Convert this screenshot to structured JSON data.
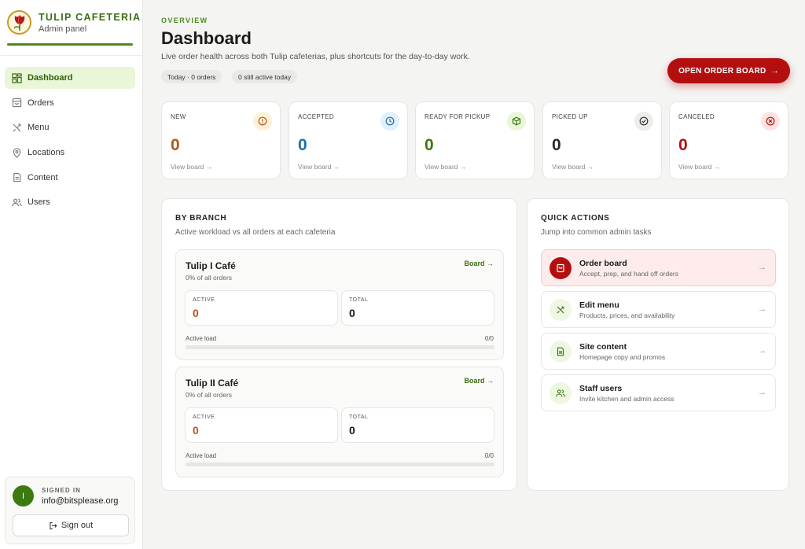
{
  "brand": {
    "name": "TULIP CAFETERIA",
    "subtitle": "Admin panel",
    "logo_icon": "tulip-icon"
  },
  "sidebar": {
    "items": [
      {
        "label": "Dashboard",
        "icon": "grid-icon",
        "active": true
      },
      {
        "label": "Orders",
        "icon": "bag-icon",
        "active": false
      },
      {
        "label": "Menu",
        "icon": "utensils-icon",
        "active": false
      },
      {
        "label": "Locations",
        "icon": "map-pin-icon",
        "active": false
      },
      {
        "label": "Content",
        "icon": "document-icon",
        "active": false
      },
      {
        "label": "Users",
        "icon": "users-icon",
        "active": false
      }
    ],
    "account": {
      "label": "SIGNED IN",
      "avatar_initial": "I",
      "email": "info@bitsplease.org",
      "sign_out": "Sign out"
    }
  },
  "header": {
    "eyebrow": "OVERVIEW",
    "title": "Dashboard",
    "subtitle": "Live order health across both Tulip cafeterias, plus shortcuts for the day-to-day work.",
    "pills": [
      "Today · 0 orders",
      "0 still active today"
    ],
    "primary_button": "OPEN ORDER BOARD",
    "primary_arrow": "→"
  },
  "stats": [
    {
      "label": "NEW",
      "value": "0",
      "link": "View board →",
      "color": "#b4561a",
      "badge_bg": "#fdf1d9",
      "icon": "alert-icon"
    },
    {
      "label": "ACCEPTED",
      "value": "0",
      "link": "View board →",
      "color": "#1f6fa8",
      "badge_bg": "#e2f0fb",
      "icon": "clock-icon"
    },
    {
      "label": "READY FOR PICKUP",
      "value": "0",
      "link": "View board →",
      "color": "#3b7a10",
      "badge_bg": "#e9f6d7",
      "icon": "package-icon"
    },
    {
      "label": "PICKED UP",
      "value": "0",
      "link": "View board →",
      "color": "#2a2a2a",
      "badge_bg": "#ececea",
      "icon": "check-circle-icon"
    },
    {
      "label": "CANCELED",
      "value": "0",
      "link": "View board →",
      "color": "#b40f0f",
      "badge_bg": "#fde4e2",
      "icon": "x-circle-icon"
    }
  ],
  "by_branch": {
    "title": "BY BRANCH",
    "subtitle": "Active workload vs all orders at each cafeteria",
    "branches": [
      {
        "name": "Tulip I Café",
        "share": "0% of all orders",
        "board_label": "Board →",
        "active_label": "ACTIVE",
        "active": "0",
        "total_label": "TOTAL",
        "total": "0",
        "load_label": "Active load",
        "load": "0/0",
        "load_fraction": 0
      },
      {
        "name": "Tulip II Café",
        "share": "0% of all orders",
        "board_label": "Board →",
        "active_label": "ACTIVE",
        "active": "0",
        "total_label": "TOTAL",
        "total": "0",
        "load_label": "Active load",
        "load": "0/0",
        "load_fraction": 0
      }
    ]
  },
  "quick_actions": {
    "title": "QUICK ACTIONS",
    "subtitle": "Jump into common admin tasks",
    "items": [
      {
        "title": "Order board",
        "subtitle": "Accept, prep, and hand off orders",
        "icon": "receipt-icon",
        "arrow": "→"
      },
      {
        "title": "Edit menu",
        "subtitle": "Products, prices, and availability",
        "icon": "utensils-icon",
        "arrow": "→"
      },
      {
        "title": "Site content",
        "subtitle": "Homepage copy and promos",
        "icon": "document-icon",
        "arrow": "→"
      },
      {
        "title": "Staff users",
        "subtitle": "Invite kitchen and admin access",
        "icon": "users-icon",
        "arrow": "→"
      }
    ]
  },
  "colors": {
    "brand_green": "#3b6e12",
    "accent_red": "#b40f0f",
    "active_nav_bg": "#e9f6d7"
  }
}
